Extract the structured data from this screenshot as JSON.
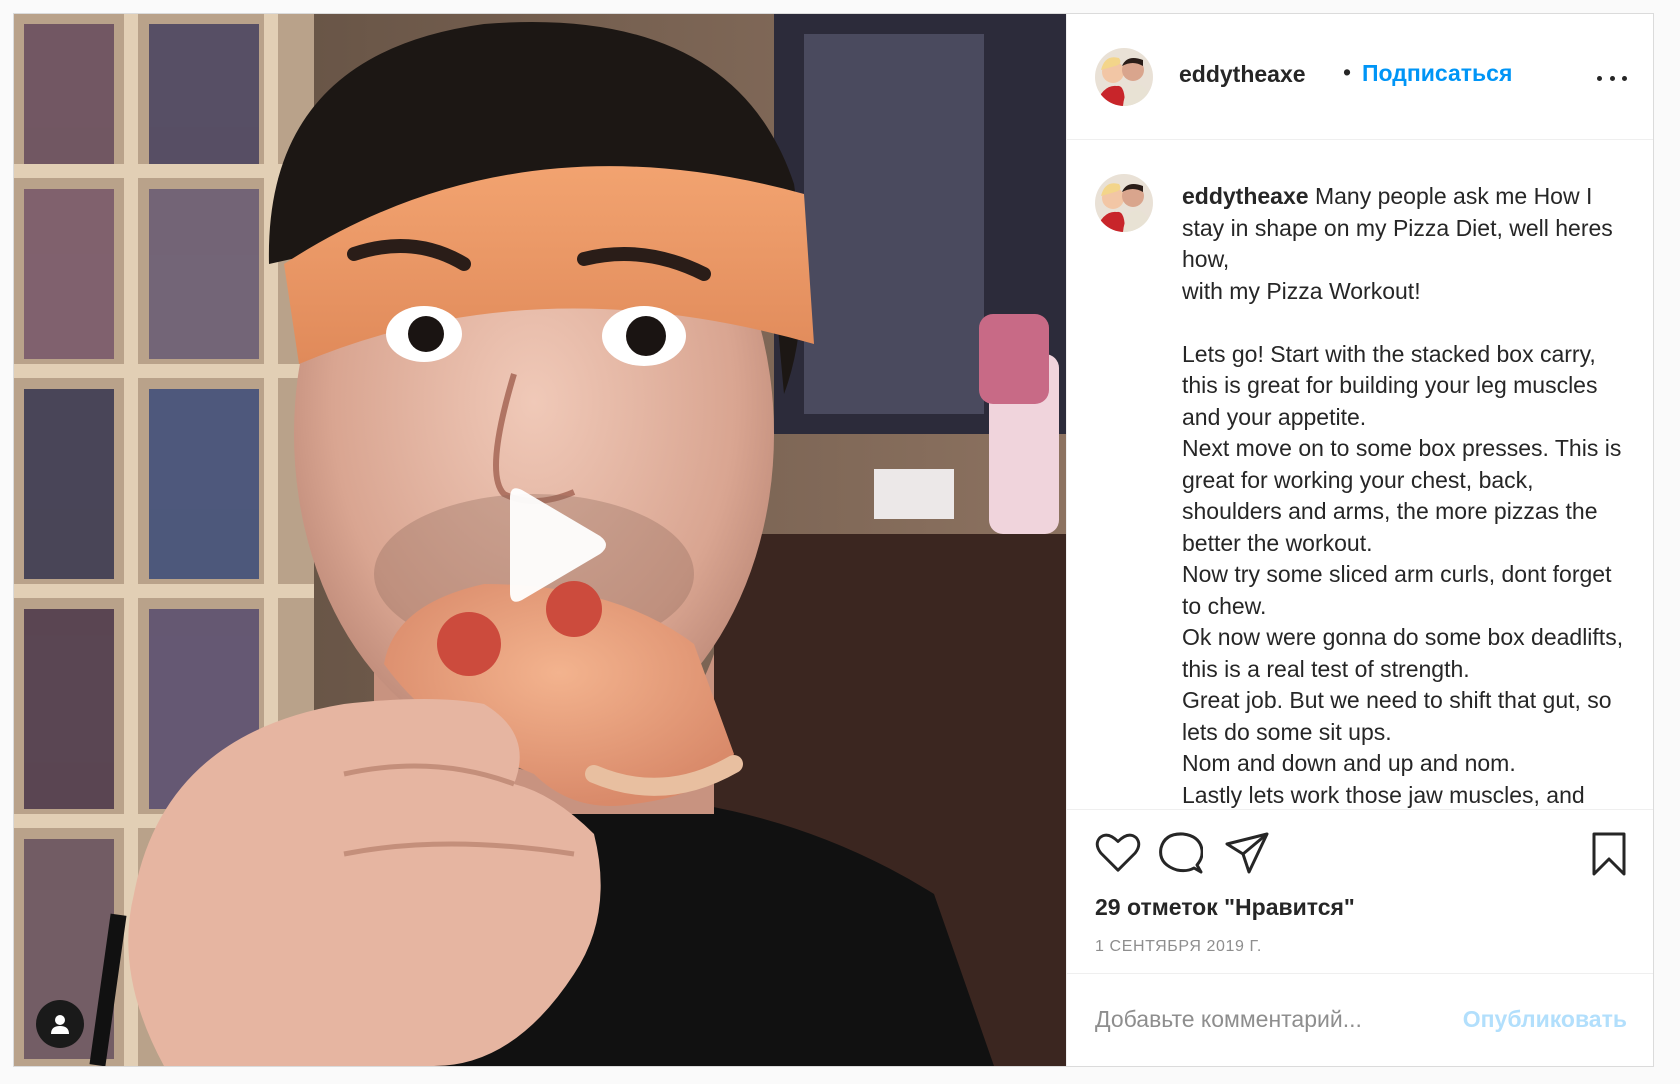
{
  "media": {
    "type": "video"
  },
  "header": {
    "username": "eddytheaxe",
    "separator": "•",
    "follow_label": "Подписаться"
  },
  "caption": {
    "username": "eddytheaxe",
    "text": " Many people ask me How I stay in shape on my Pizza Diet, well heres how,\nwith my Pizza Workout!\n\nLets go! Start with the stacked box carry, this is great for building your leg muscles and your appetite.\nNext move on to some box presses. This is great for working your chest, back, shoulders and arms, the more pizzas the better the workout.\nNow try some sliced arm curls, dont forget to chew.\nOk now were gonna do some box deadlifts, this is a real test of strength.\nGreat job. But we need to shift that gut, so lets do some sit ups.\nNom and down and up and nom.\nLastly lets work those jaw muscles, and"
  },
  "actions": {
    "likes_text": "29 отметок \"Нравится\"",
    "date_text": "1 СЕНТЯБРЯ 2019 Г."
  },
  "comment": {
    "placeholder": "Добавьте комментарий...",
    "publish_label": "Опубликовать"
  },
  "colors": {
    "link_blue": "#0095f6",
    "publish_disabled": "#b2dffc",
    "secondary_text": "#8e8e8e",
    "border": "#dbdbdb"
  },
  "icons": [
    "play-icon",
    "user-tag-icon",
    "more-options-icon",
    "heart-icon",
    "comment-icon",
    "share-icon",
    "bookmark-icon"
  ]
}
